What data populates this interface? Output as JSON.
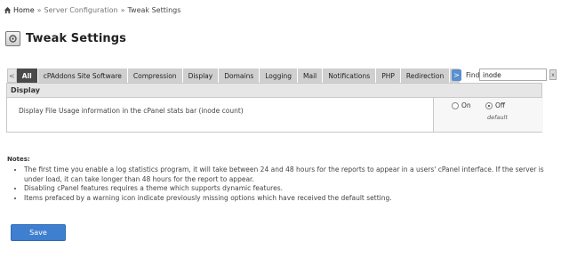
{
  "breadcrumb": {
    "home": "Home",
    "separator": "»",
    "items": [
      "Server Configuration",
      "Tweak Settings"
    ]
  },
  "page": {
    "title": "Tweak Settings"
  },
  "tabs": {
    "left_arrow": "<",
    "right_arrow": ">",
    "items": [
      {
        "label": "All",
        "active": true
      },
      {
        "label": "cPAddons Site Software"
      },
      {
        "label": "Compression"
      },
      {
        "label": "Display"
      },
      {
        "label": "Domains"
      },
      {
        "label": "Logging"
      },
      {
        "label": "Mail"
      },
      {
        "label": "Notifications"
      },
      {
        "label": "PHP"
      },
      {
        "label": "Redirection"
      },
      {
        "label": "S"
      }
    ]
  },
  "find": {
    "label": "Find",
    "value": "inode",
    "clear": "x"
  },
  "section": {
    "title": "Display",
    "setting": {
      "label": "Display File Usage information in the cPanel stats bar (inode count)",
      "option_on": "On",
      "option_off": "Off",
      "selected": "Off",
      "default_note": "default"
    }
  },
  "notes": {
    "title": "Notes:",
    "items": [
      "The first time you enable a log statistics program, it will take between 24 and 48 hours for the reports to appear in a users' cPanel interface. If the server is under load, it can take longer than 48 hours for the report to appear.",
      "Disabling cPanel features requires a theme which supports dynamic features.",
      "Items prefaced by a warning icon indicate previously missing options which have received the default setting."
    ]
  },
  "actions": {
    "save_label": "Save"
  },
  "colors": {
    "accent": "#3f7fcf",
    "active_tab": "#4a4a4a",
    "tab": "#cfcfcf"
  }
}
